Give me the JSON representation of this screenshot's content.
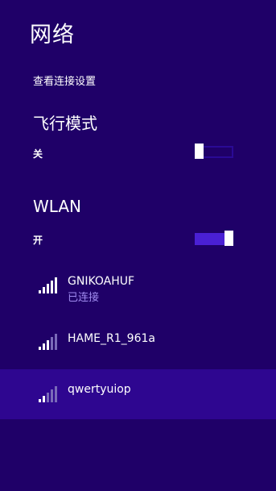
{
  "panel": {
    "title": "网络",
    "settings_link": "查看连接设置"
  },
  "airplane_mode": {
    "heading": "飞行模式",
    "state": "关",
    "on": false
  },
  "wlan": {
    "heading": "WLAN",
    "state": "开",
    "on": true
  },
  "networks": [
    {
      "name": "GNIKOAHUF",
      "status": "已连接",
      "signal_bars": 5,
      "signal_icon": "wifi-signal-icon"
    },
    {
      "name": "HAME_R1_961a",
      "signal_bars": 3,
      "signal_icon": "wifi-signal-icon"
    },
    {
      "name": "qwertyuiop",
      "signal_bars": 2,
      "signal_icon": "wifi-signal-icon",
      "selected": true
    }
  ],
  "colors": {
    "background": "#1f0068",
    "selected_row": "#2e0690",
    "toggle_on": "#4a20d4",
    "toggle_off_border": "#2a0a95",
    "status_text": "#a08cf0",
    "signal_dim": "#7a6ab8"
  }
}
